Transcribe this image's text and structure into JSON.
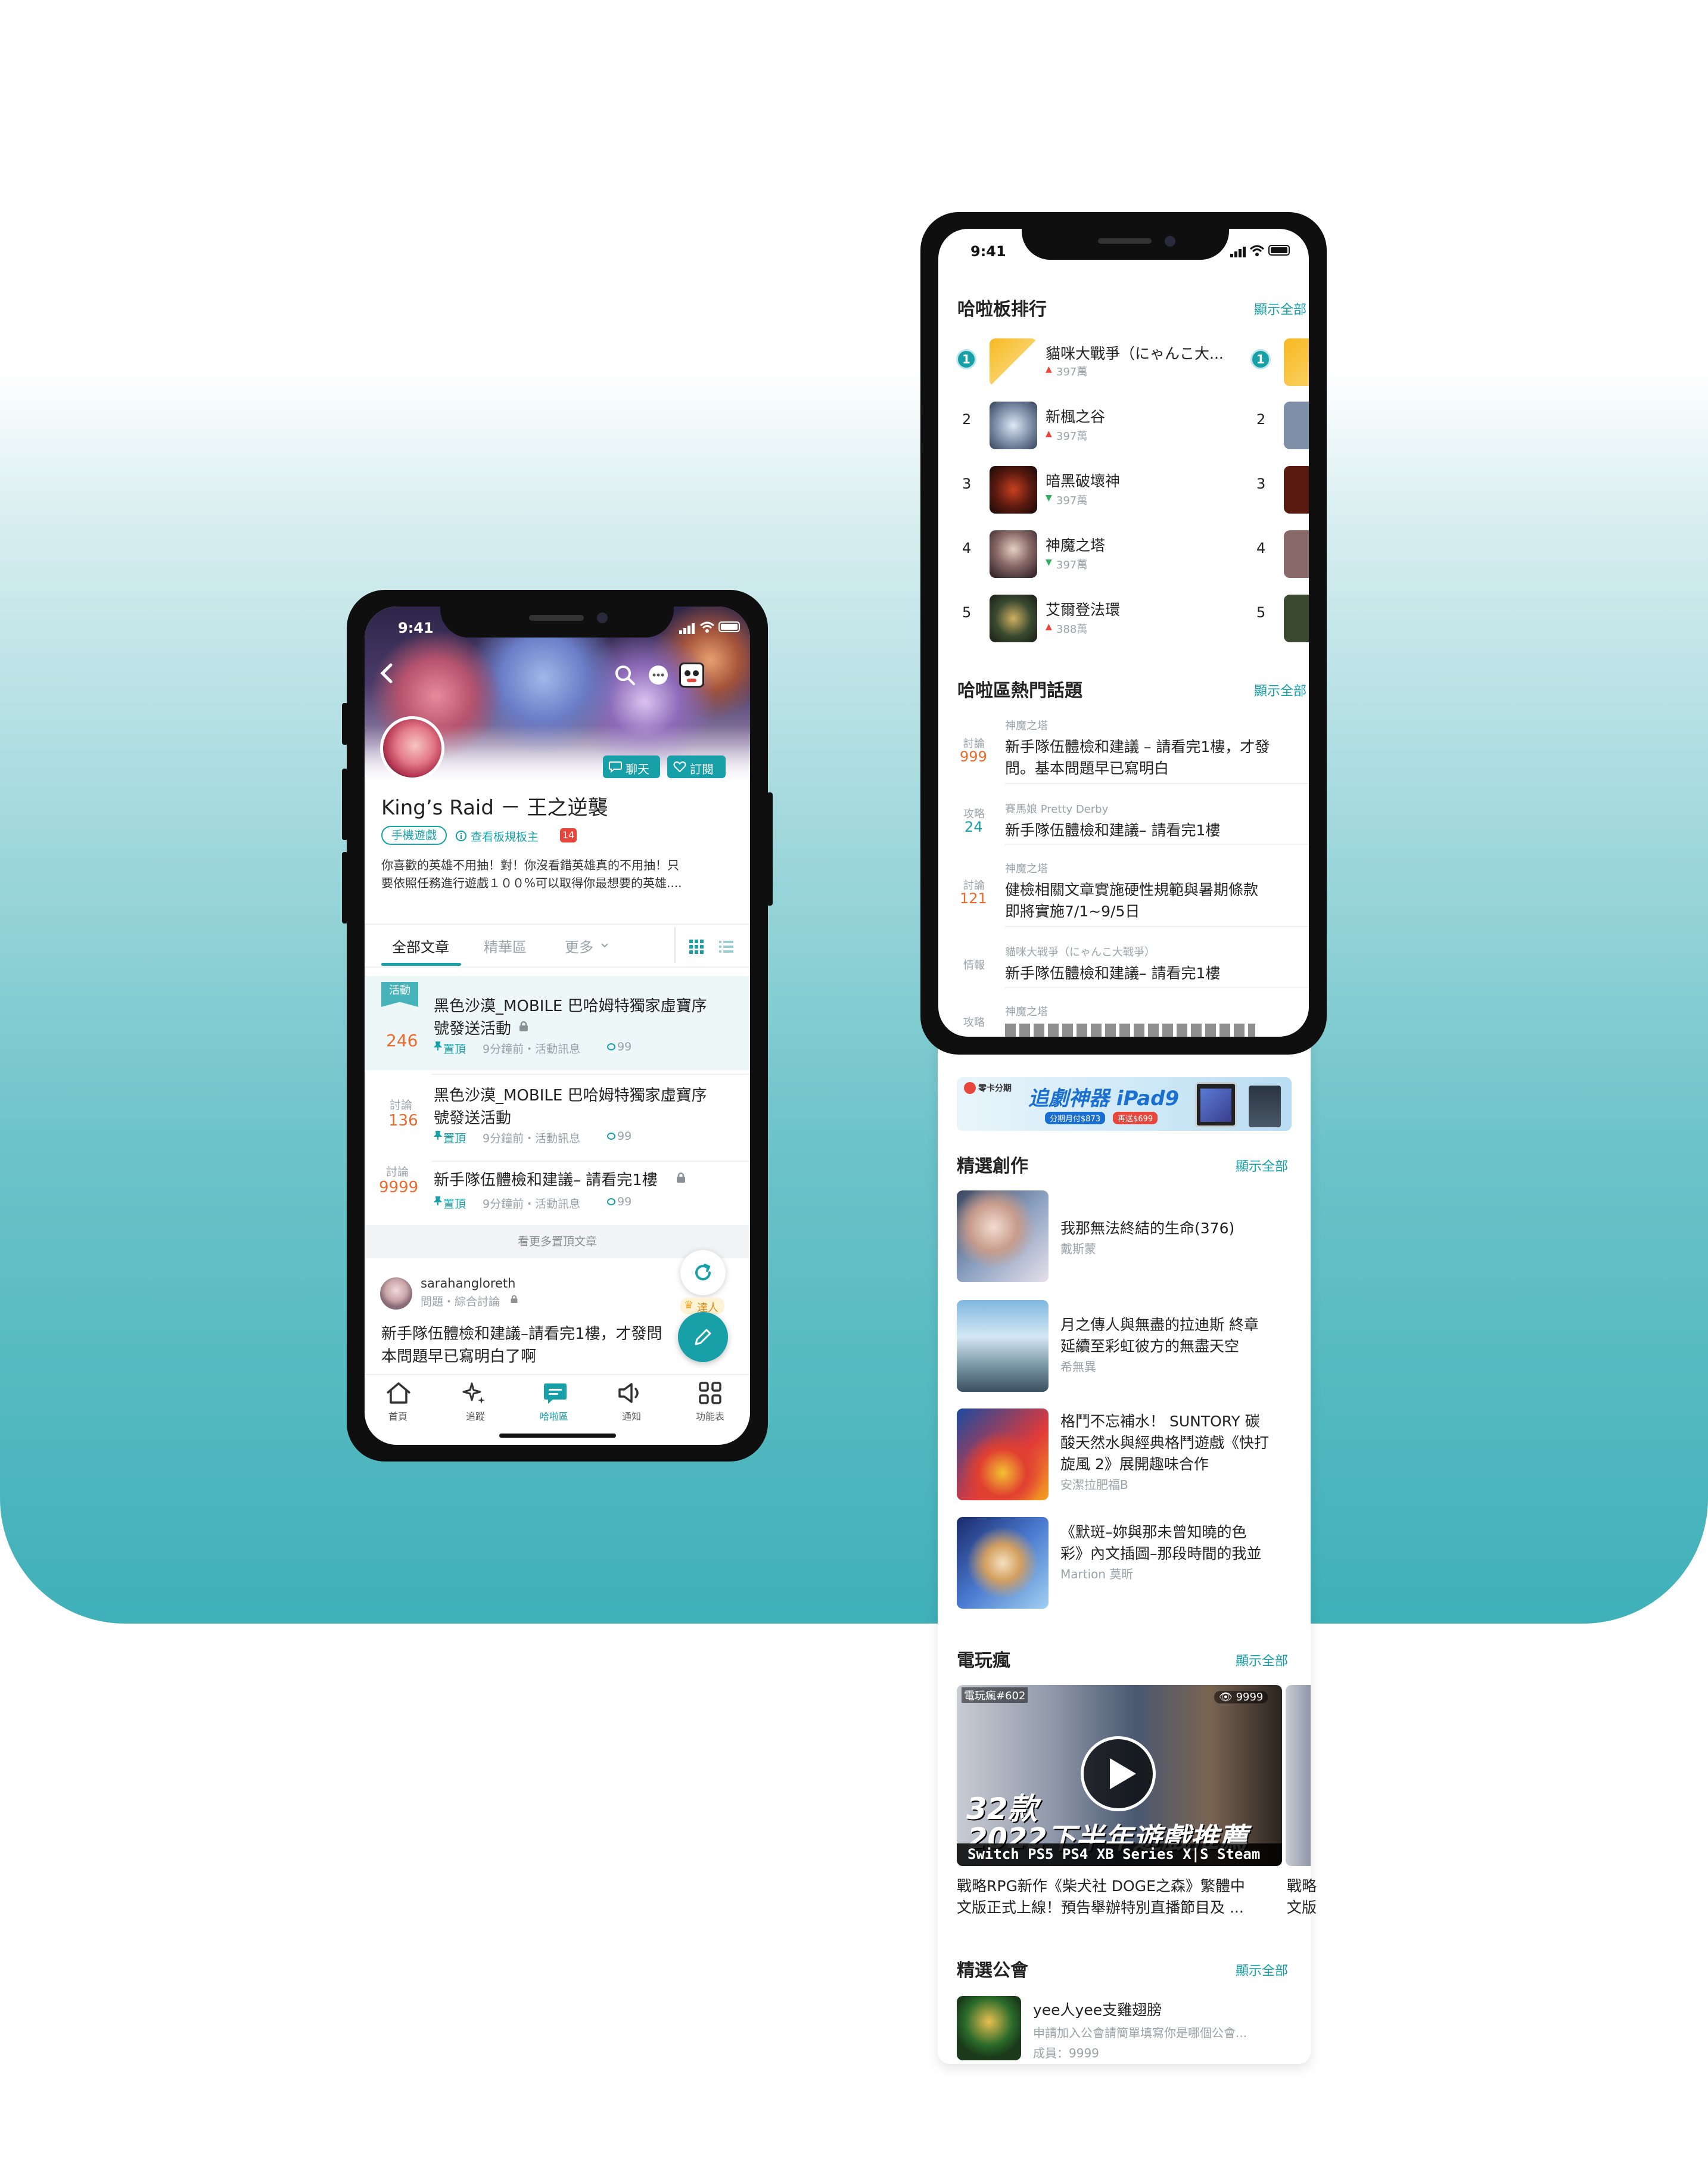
{
  "colors": {
    "teal": "#17a0a8",
    "orange": "#ec6a2c",
    "red": "#e8463c",
    "green": "#2fb15a",
    "grey": "#9aa3a8"
  },
  "left": {
    "status_time": "9:41",
    "board_title": "King’s Raid － 王之逆襲",
    "chat_btn": "聊天",
    "subscribe_btn": "訂閱",
    "category_tag": "手機遊戲",
    "view_rules": "查看板規板主",
    "rules_badge": "14",
    "desc_line1": "你喜歡的英雄不用抽！對！你沒看錯英雄真的不用抽！只",
    "desc_line2": "要依照任務進行遊戲１００%可以取得你最想要的英雄....",
    "tabs": [
      "全部文章",
      "精華區",
      "更多"
    ],
    "posts": [
      {
        "tag": "活動",
        "count": "246",
        "title1": "黑色沙漠_MOBILE 巴哈姆特獨家虛寶序",
        "title2": "號發送活動",
        "pin": "置頂",
        "meta": "9分鐘前・活動訊息",
        "views": "99"
      },
      {
        "type": "討論",
        "count": "136",
        "title1": "黑色沙漠_MOBILE 巴哈姆特獨家虛寶序",
        "title2": "號發送活動",
        "pin": "置頂",
        "meta": "9分鐘前・活動訊息",
        "views": "99"
      },
      {
        "type": "討論",
        "count": "9999",
        "title1": "新手隊伍體檢和建議– 請看完1樓",
        "pin": "置頂",
        "meta": "9分鐘前・活動訊息",
        "views": "99"
      }
    ],
    "more_pinned": "看更多置頂文章",
    "user": {
      "name": "sarahangloreth",
      "meta": "問題・綜合討論",
      "badge": "達人",
      "text1": "新手隊伍體檢和建議–請看完1樓，才發問",
      "text2": "本問題早已寫明白了啊"
    },
    "nav": [
      "首頁",
      "追蹤",
      "哈啦區",
      "通知",
      "功能表"
    ]
  },
  "right": {
    "status_time": "9:41",
    "ranking": {
      "title": "哈啦板排行",
      "show_all": "顯示全部",
      "items": [
        {
          "rank": "1",
          "name": "貓咪大戰爭（にゃんこ大...",
          "pop": "397萬",
          "trend": "up"
        },
        {
          "rank": "2",
          "name": "新楓之谷",
          "pop": "397萬",
          "trend": "up"
        },
        {
          "rank": "3",
          "name": "暗黑破壞神",
          "pop": "397萬",
          "trend": "down"
        },
        {
          "rank": "4",
          "name": "神魔之塔",
          "pop": "397萬",
          "trend": "down"
        },
        {
          "rank": "5",
          "name": "艾爾登法環",
          "pop": "388萬",
          "trend": "up"
        }
      ],
      "second_column_ranks": [
        "1",
        "2",
        "3",
        "4",
        "5"
      ]
    },
    "hot": {
      "title": "哈啦區熱門話題",
      "show_all": "顯示全部",
      "items": [
        {
          "board": "神魔之塔",
          "type": "討論",
          "count": "999",
          "line1": "新手隊伍體檢和建議 – 請看完1樓，才發",
          "line2": "問。基本問題早已寫明白"
        },
        {
          "board": "賽馬娘 Pretty Derby",
          "type": "攻略",
          "count": "24",
          "line1": "新手隊伍體檢和建議– 請看完1樓",
          "line2": ""
        },
        {
          "board": "神魔之塔",
          "type": "討論",
          "count": "121",
          "line1": "健檢相關文章實施硬性規範與暑期條款",
          "line2": "即將實施7/1~9/5日"
        },
        {
          "board": "貓咪大戰爭（にゃんこ大戰爭）",
          "type": "情報",
          "count": "",
          "line1": "新手隊伍體檢和建議– 請看完1樓",
          "line2": ""
        },
        {
          "board": "神魔之塔",
          "type": "攻略",
          "count": "",
          "line1": "",
          "line2": ""
        }
      ]
    },
    "ad": {
      "brand": "零卡分期",
      "headline": "追劇神器 iPad9",
      "sub1": "分期月付$873",
      "sub2": "再送$699"
    },
    "creation": {
      "title": "精選創作",
      "show_all": "顯示全部",
      "items": [
        {
          "line1": "我那無法終結的生命(376)",
          "line2": "",
          "author": "戴斯蒙"
        },
        {
          "line1": "月之傳人與無盡的拉迪斯 終章",
          "line2": "延續至彩虹彼方的無盡天空",
          "author": "希無異"
        },
        {
          "line1": "格鬥不忘補水！ SUNTORY 碳",
          "line2": "酸天然水與經典格鬥遊戲《快打",
          "line3": "旋風 2》展開趣味合作",
          "author": "安潔拉肥福B"
        },
        {
          "line1": "《默斑–妳與那未曾知曉的色",
          "line2": "彩》內文插圖–那段時間的我並",
          "author": "Martion 莫昕"
        }
      ]
    },
    "video": {
      "title": "電玩瘋",
      "show_all": "顯示全部",
      "ep": "電玩瘋#602",
      "views": "9999",
      "big1": "32款",
      "big2": "2022下半年遊戲推薦",
      "platforms": "Switch PS5 PS4 XB Series X|S Steam",
      "cap1": "戰略RPG新作《柴犬社 DOGE之森》繁體中",
      "cap2": "文版正式上線！預告舉辦特別直播節目及 ...",
      "peek1": "戰略",
      "peek2": "文版"
    },
    "guild": {
      "title": "精選公會",
      "show_all": "顯示全部",
      "name": "yee人yee支雞翅膀",
      "desc": "申請加入公會請簡單填寫你是哪個公會...",
      "members": "成員：9999"
    }
  }
}
